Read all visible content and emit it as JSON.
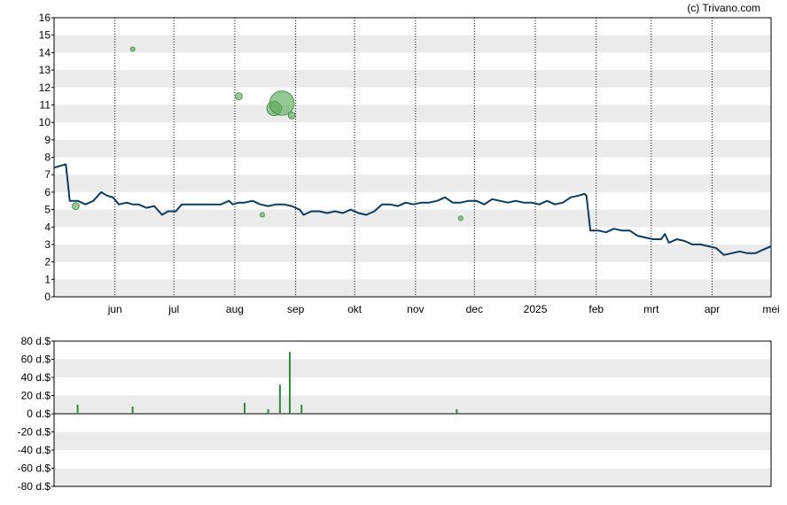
{
  "copyright": "(c) Trivano.com",
  "colors": {
    "price_line": "#0d3b5e",
    "insider_bubble": "#5aaa5a",
    "volume_bar": "#2e8b3a",
    "band_fill": "#ebebeb",
    "frame": "#000000"
  },
  "chart_data": [
    {
      "type": "line",
      "title": "",
      "ylim": [
        0,
        16
      ],
      "y_ticks": [
        "0",
        "1",
        "2",
        "3",
        "4",
        "5",
        "6",
        "7",
        "8",
        "9",
        "10",
        "11",
        "12",
        "13",
        "14",
        "15",
        "16"
      ],
      "x_ticks": [
        "jun",
        "jul",
        "aug",
        "sep",
        "okt",
        "nov",
        "dec",
        "2025",
        "feb",
        "mrt",
        "apr",
        "mei"
      ],
      "xlim": [
        "2024-05-01",
        "2025-05-01"
      ],
      "grid": "alternating horizontal bands, dotted vertical lines at month starts",
      "series": [
        {
          "x": [
            "2024-05-01",
            "2024-05-04",
            "2024-05-07",
            "2024-05-09",
            "2024-05-13",
            "2024-05-17",
            "2024-05-21",
            "2024-05-25",
            "2024-05-28",
            "2024-05-31",
            "2024-06-03",
            "2024-06-07",
            "2024-06-10",
            "2024-06-13",
            "2024-06-17",
            "2024-06-21",
            "2024-06-25",
            "2024-06-28",
            "2024-07-02",
            "2024-07-05",
            "2024-07-10",
            "2024-07-13",
            "2024-07-17",
            "2024-07-21",
            "2024-07-25",
            "2024-07-29",
            "2024-07-31",
            "2024-08-03",
            "2024-08-06",
            "2024-08-10",
            "2024-08-14",
            "2024-08-18",
            "2024-08-22",
            "2024-08-26",
            "2024-08-30",
            "2024-09-03",
            "2024-09-05",
            "2024-09-09",
            "2024-09-13",
            "2024-09-17",
            "2024-09-21",
            "2024-09-25",
            "2024-09-29",
            "2024-10-03",
            "2024-10-07",
            "2024-10-11",
            "2024-10-15",
            "2024-10-19",
            "2024-10-23",
            "2024-10-27",
            "2024-10-31",
            "2024-11-04",
            "2024-11-08",
            "2024-11-12",
            "2024-11-16",
            "2024-11-20",
            "2024-11-24",
            "2024-11-28",
            "2024-12-02",
            "2024-12-06",
            "2024-12-10",
            "2024-12-14",
            "2024-12-18",
            "2024-12-22",
            "2024-12-26",
            "2024-12-30",
            "2025-01-03",
            "2025-01-07",
            "2025-01-11",
            "2025-01-15",
            "2025-01-19",
            "2025-01-23",
            "2025-01-26",
            "2025-01-27",
            "2025-01-29",
            "2025-02-02",
            "2025-02-06",
            "2025-02-10",
            "2025-02-14",
            "2025-02-18",
            "2025-02-22",
            "2025-02-26",
            "2025-03-02",
            "2025-03-06",
            "2025-03-08",
            "2025-03-10",
            "2025-03-14",
            "2025-03-18",
            "2025-03-22",
            "2025-03-26",
            "2025-03-30",
            "2025-04-03",
            "2025-04-07",
            "2025-04-11",
            "2025-04-15",
            "2025-04-19",
            "2025-04-23",
            "2025-04-27",
            "2025-05-01"
          ],
          "values": [
            7.4,
            7.5,
            7.6,
            5.5,
            5.5,
            5.3,
            5.5,
            6.0,
            5.8,
            5.7,
            5.3,
            5.4,
            5.3,
            5.3,
            5.1,
            5.2,
            4.7,
            4.9,
            4.9,
            5.3,
            5.3,
            5.3,
            5.3,
            5.3,
            5.3,
            5.5,
            5.3,
            5.4,
            5.4,
            5.5,
            5.3,
            5.2,
            5.3,
            5.3,
            5.2,
            5.0,
            4.7,
            4.9,
            4.9,
            4.8,
            4.9,
            4.8,
            5.0,
            4.8,
            4.7,
            4.9,
            5.3,
            5.3,
            5.2,
            5.4,
            5.3,
            5.4,
            5.4,
            5.5,
            5.7,
            5.4,
            5.4,
            5.5,
            5.5,
            5.3,
            5.6,
            5.5,
            5.4,
            5.5,
            5.4,
            5.4,
            5.3,
            5.5,
            5.3,
            5.4,
            5.7,
            5.8,
            5.9,
            5.8,
            3.8,
            3.8,
            3.7,
            3.9,
            3.8,
            3.8,
            3.5,
            3.4,
            3.3,
            3.3,
            3.6,
            3.1,
            3.3,
            3.2,
            3.0,
            3.0,
            2.9,
            2.8,
            2.4,
            2.5,
            2.6,
            2.5,
            2.5,
            2.7,
            2.9
          ]
        }
      ],
      "insider_bubbles": [
        {
          "x": "2024-05-12",
          "y": 5.2,
          "size": 2
        },
        {
          "x": "2024-06-10",
          "y": 14.2,
          "size": 1
        },
        {
          "x": "2024-08-03",
          "y": 11.5,
          "size": 2
        },
        {
          "x": "2024-08-15",
          "y": 4.7,
          "size": 1
        },
        {
          "x": "2024-08-21",
          "y": 10.8,
          "size": 5
        },
        {
          "x": "2024-08-25",
          "y": 11.1,
          "size": 9
        },
        {
          "x": "2024-08-30",
          "y": 10.4,
          "size": 2
        },
        {
          "x": "2024-11-24",
          "y": 4.5,
          "size": 1
        }
      ]
    },
    {
      "type": "bar",
      "title": "",
      "ylim": [
        -80,
        80
      ],
      "y_ticks": [
        "80 d.$",
        "60 d.$",
        "40 d.$",
        "20 d.$",
        "0 d.$",
        "-20 d.$",
        "-40 d.$",
        "-60 d.$",
        "-80 d.$"
      ],
      "y_tick_values": [
        80,
        60,
        40,
        20,
        0,
        -20,
        -40,
        -60,
        -80
      ],
      "grid": "alternating horizontal bands",
      "bars": [
        {
          "x": "2024-05-13",
          "value": 10
        },
        {
          "x": "2024-06-10",
          "value": 8
        },
        {
          "x": "2024-08-06",
          "value": 12
        },
        {
          "x": "2024-08-18",
          "value": 5
        },
        {
          "x": "2024-08-24",
          "value": 32
        },
        {
          "x": "2024-08-29",
          "value": 68
        },
        {
          "x": "2024-09-04",
          "value": 10
        },
        {
          "x": "2024-11-22",
          "value": 5
        }
      ]
    }
  ]
}
